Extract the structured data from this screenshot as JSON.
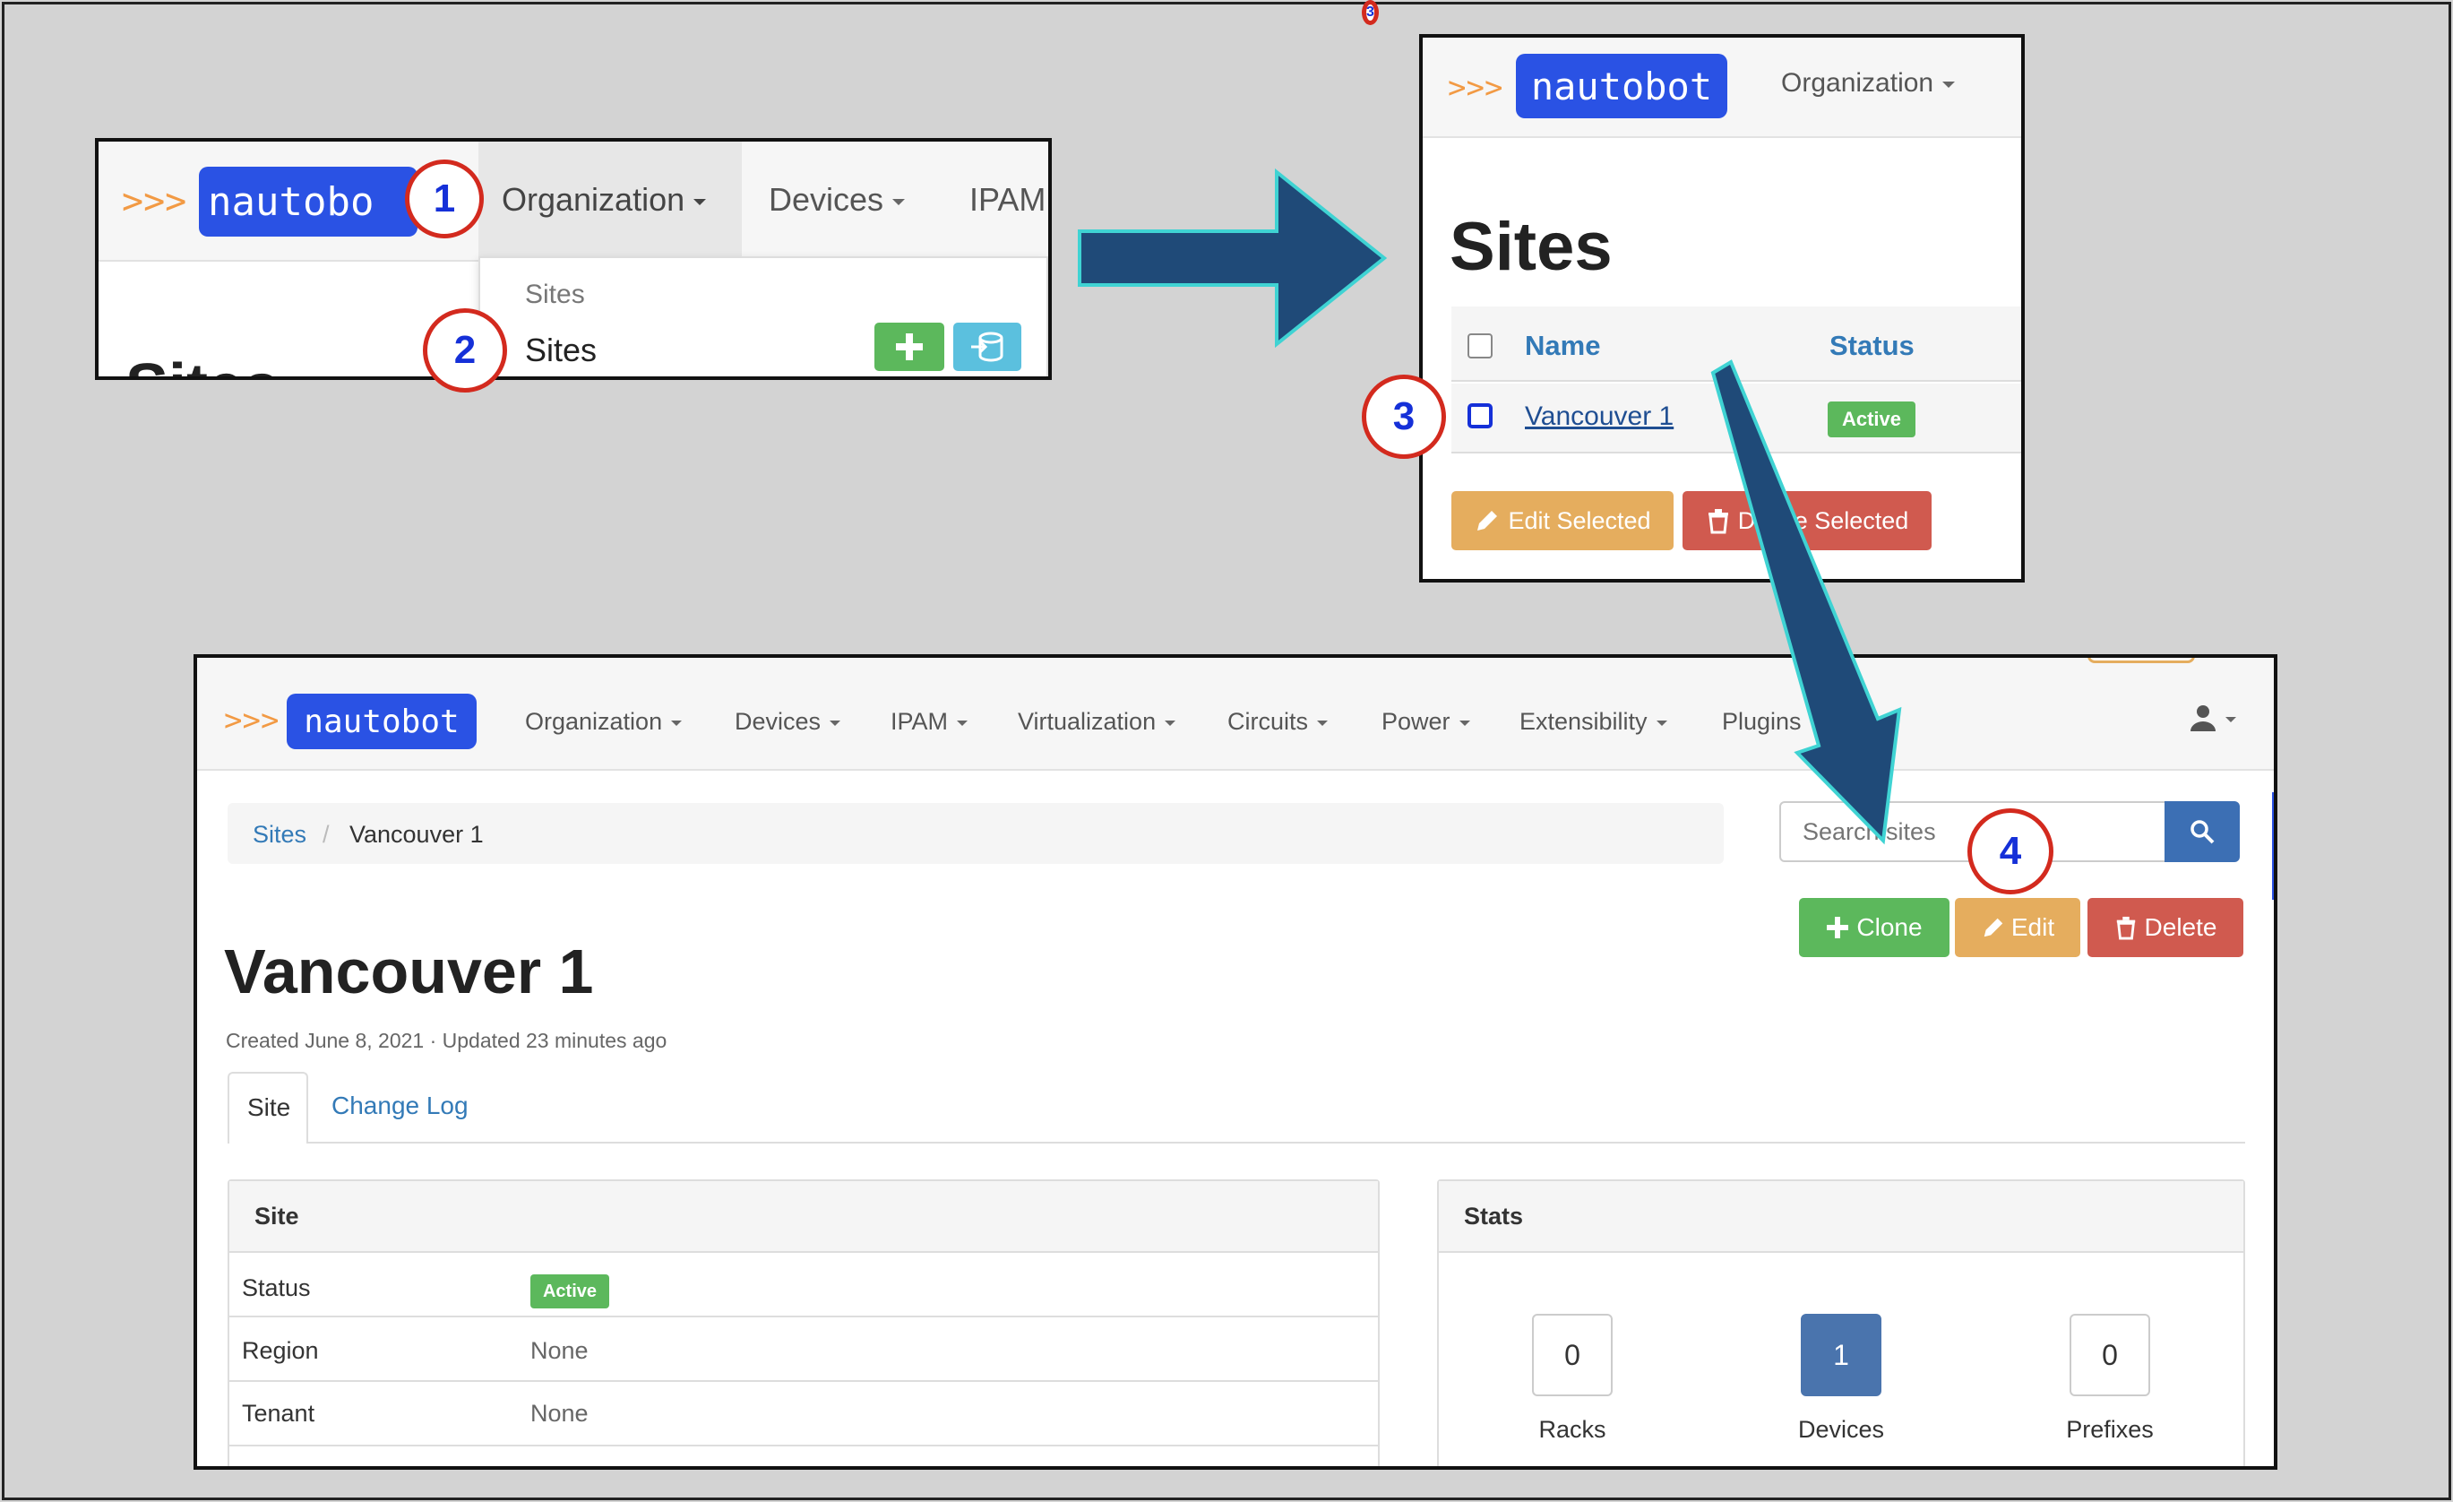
{
  "logo": {
    "chevrons": ">>>",
    "name": "nautobot"
  },
  "callouts": {
    "c1": "1",
    "c2": "2",
    "c3": "3",
    "c4": "4"
  },
  "panel1": {
    "nav": {
      "organization": "Organization",
      "devices": "Devices",
      "ipam": "IPAM"
    },
    "menu": {
      "header": "Sites",
      "item": "Sites"
    },
    "add_icon": "plus-icon",
    "import_icon": "import-icon",
    "logo_partial": "nautobo"
  },
  "panel2": {
    "nav": {
      "organization": "Organization"
    },
    "title": "Sites",
    "table": {
      "col_name": "Name",
      "col_status": "Status",
      "row_name": "Vancouver 1",
      "row_status": "Active"
    },
    "buttons": {
      "edit_selected": "Edit Selected",
      "delete_selected": "Delete Selected"
    }
  },
  "panel3": {
    "nav": [
      "Organization",
      "Devices",
      "IPAM",
      "Virtualization",
      "Circuits",
      "Power",
      "Extensibility",
      "Plugins"
    ],
    "breadcrumb": {
      "root": "Sites",
      "separator": "/",
      "current": "Vancouver 1"
    },
    "search": {
      "placeholder": "Search sites"
    },
    "buttons": {
      "clone": "Clone",
      "edit": "Edit",
      "delete": "Delete"
    },
    "title": "Vancouver 1",
    "meta": "Created June 8, 2021 · Updated 23 minutes ago",
    "tabs": {
      "site": "Site",
      "changelog": "Change Log"
    },
    "site_table": {
      "heading": "Site",
      "rows": [
        {
          "label": "Status",
          "value": "Active"
        },
        {
          "label": "Region",
          "value": "None"
        },
        {
          "label": "Tenant",
          "value": "None"
        }
      ]
    },
    "stats": {
      "heading": "Stats",
      "items": [
        {
          "label": "Racks",
          "value": "0"
        },
        {
          "label": "Devices",
          "value": "1"
        },
        {
          "label": "Prefixes",
          "value": "0"
        }
      ]
    }
  },
  "colors": {
    "accent_blue": "#337ab7",
    "arrow": "#1f4a78",
    "arrow_outline": "#3fd3d3",
    "callout_ring": "#d32a1e",
    "success": "#5cb85c",
    "warning": "#e5ad5e",
    "danger": "#d05a4f"
  }
}
